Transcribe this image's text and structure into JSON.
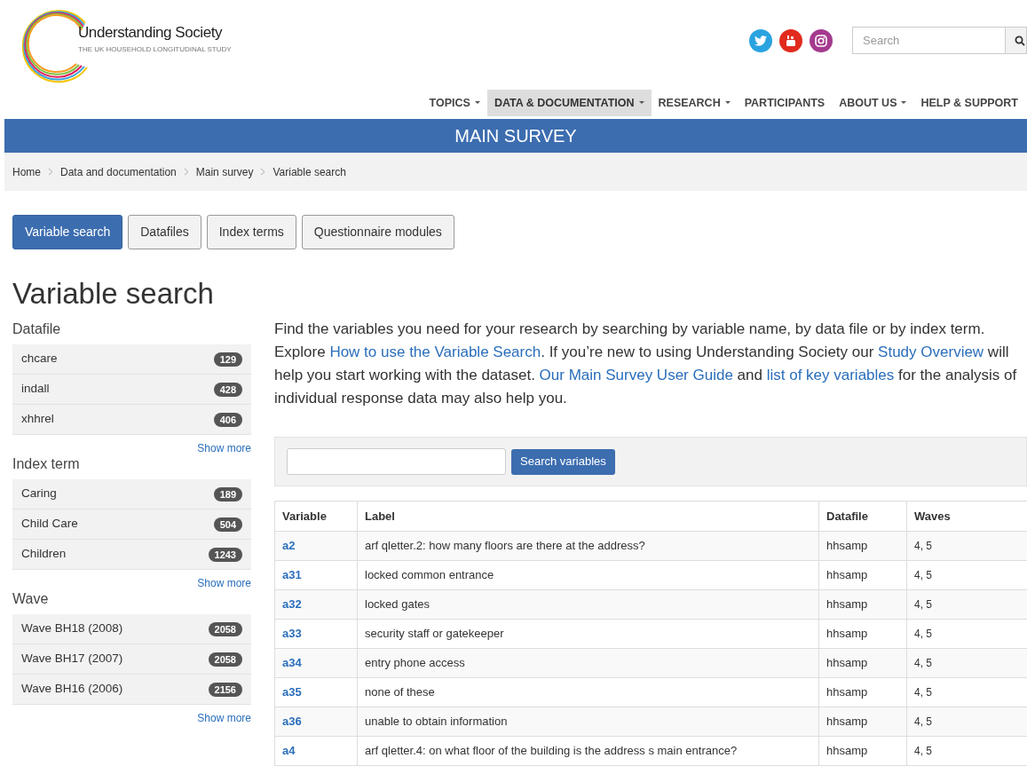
{
  "brand": {
    "name": "Understanding Society",
    "tagline": "THE UK HOUSEHOLD LONGITUDINAL STUDY"
  },
  "search": {
    "placeholder": "Search"
  },
  "nav": [
    {
      "label": "TOPICS",
      "dropdown": true,
      "selected": false
    },
    {
      "label": "DATA & DOCUMENTATION",
      "dropdown": true,
      "selected": true
    },
    {
      "label": "RESEARCH",
      "dropdown": true,
      "selected": false
    },
    {
      "label": "PARTICIPANTS",
      "dropdown": false,
      "selected": false
    },
    {
      "label": "ABOUT US",
      "dropdown": true,
      "selected": false
    },
    {
      "label": "HELP & SUPPORT",
      "dropdown": false,
      "selected": false
    }
  ],
  "banner": "MAIN SURVEY",
  "breadcrumb": [
    "Home",
    "Data and documentation",
    "Main survey",
    "Variable search"
  ],
  "tabs": [
    {
      "label": "Variable search",
      "selected": true
    },
    {
      "label": "Datafiles",
      "selected": false
    },
    {
      "label": "Index terms",
      "selected": false
    },
    {
      "label": "Questionnaire modules",
      "selected": false
    }
  ],
  "title": "Variable search",
  "facets": [
    {
      "heading": "Datafile",
      "items": [
        {
          "label": "chcare",
          "count": "129"
        },
        {
          "label": "indall",
          "count": "428"
        },
        {
          "label": "xhhrel",
          "count": "406"
        }
      ],
      "more": "Show more"
    },
    {
      "heading": "Index term",
      "items": [
        {
          "label": "Caring",
          "count": "189"
        },
        {
          "label": "Child Care",
          "count": "504"
        },
        {
          "label": "Children",
          "count": "1243"
        }
      ],
      "more": "Show more"
    },
    {
      "heading": "Wave",
      "items": [
        {
          "label": "Wave BH18 (2008)",
          "count": "2058"
        },
        {
          "label": "Wave BH17 (2007)",
          "count": "2058"
        },
        {
          "label": "Wave BH16 (2006)",
          "count": "2156"
        }
      ],
      "more": "Show more"
    }
  ],
  "intro": [
    {
      "text": "Find the variables you need for your research by searching by variable name, by data file or by index term. Explore ",
      "link": false
    },
    {
      "text": "How to use the Variable Search",
      "link": true
    },
    {
      "text": ". If you’re new to using Understanding Society our ",
      "link": false
    },
    {
      "text": "Study Overview",
      "link": true
    },
    {
      "text": " will help you start working with the dataset. ",
      "link": false
    },
    {
      "text": "Our Main Survey User Guide",
      "link": true
    },
    {
      "text": " and ",
      "link": false
    },
    {
      "text": "list of key variables",
      "link": true
    },
    {
      "text": " for the analysis of individual response data may also help you.",
      "link": false
    }
  ],
  "search_button": "Search variables",
  "table": {
    "columns": [
      "Variable",
      "Label",
      "Datafile",
      "Waves"
    ],
    "rows": [
      [
        "a2",
        "arf qletter.2: how many floors are there at the address?",
        "hhsamp",
        "4, 5"
      ],
      [
        "a31",
        "locked common entrance",
        "hhsamp",
        "4, 5"
      ],
      [
        "a32",
        "locked gates",
        "hhsamp",
        "4, 5"
      ],
      [
        "a33",
        "security staff or gatekeeper",
        "hhsamp",
        "4, 5"
      ],
      [
        "a34",
        "entry phone access",
        "hhsamp",
        "4, 5"
      ],
      [
        "a35",
        "none of these",
        "hhsamp",
        "4, 5"
      ],
      [
        "a36",
        "unable to obtain information",
        "hhsamp",
        "4, 5"
      ],
      [
        "a4",
        "arf qletter.4: on what floor of the building is the address s main entrance?",
        "hhsamp",
        "4, 5"
      ]
    ]
  }
}
